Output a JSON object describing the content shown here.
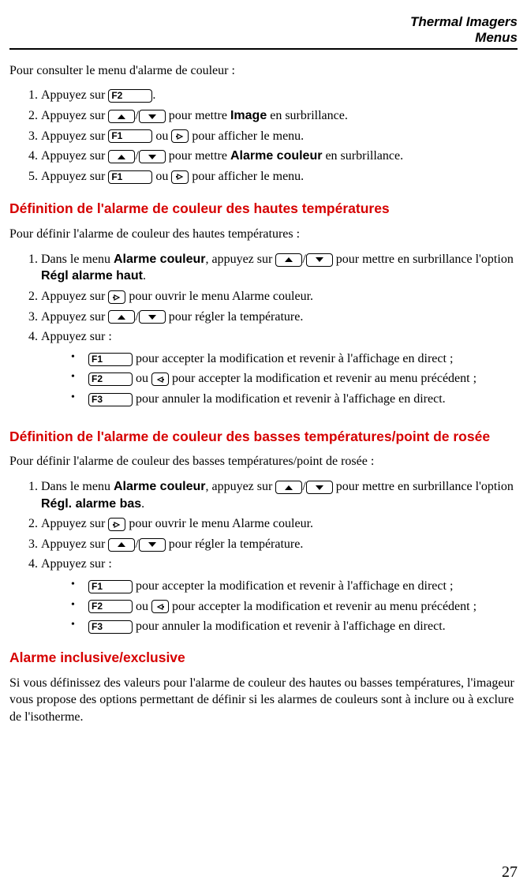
{
  "header": {
    "title1": "Thermal Imagers",
    "title2": "Menus"
  },
  "keys": {
    "F1": "F1",
    "F2": "F2",
    "F3": "F3"
  },
  "para1": "Pour consulter le menu d'alarme de couleur :",
  "list1": [
    {
      "pre": "Appuyez sur ",
      "key": "F2",
      "post": "."
    },
    {
      "pre": "Appuyez sur ",
      "mid": " pour mettre ",
      "bold": "Image",
      "post": " en surbrillance."
    },
    {
      "pre": "Appuyez sur ",
      "key": "F1",
      "mid": " ou ",
      "post": " pour afficher le menu."
    },
    {
      "pre": "Appuyez sur ",
      "mid": " pour mettre ",
      "bold": "Alarme couleur",
      "post": " en surbrillance."
    },
    {
      "pre": "Appuyez sur ",
      "key": "F1",
      "mid": " ou ",
      "post": " pour afficher le menu."
    }
  ],
  "section2": {
    "heading": "Définition de l'alarme de couleur des hautes températures",
    "intro": "Pour définir l'alarme de couleur des hautes températures :",
    "item1": {
      "pre": "Dans le menu ",
      "bold1": "Alarme couleur",
      "mid1": ", appuyez sur ",
      "mid2": " pour mettre en surbrillance l'option ",
      "bold2": "Régl alarme haut",
      "post": "."
    },
    "item2": {
      "pre": "Appuyez sur ",
      "post": " pour ouvrir le menu Alarme couleur."
    },
    "item3": {
      "pre": "Appuyez sur ",
      "post": " pour régler la température."
    },
    "item4": {
      "text": "Appuyez sur :",
      "b1": " pour accepter la modification et revenir à l'affichage en direct ;",
      "b2a": " ou ",
      "b2b": " pour accepter la modification et revenir au menu précédent ;",
      "b3": " pour annuler la modification et revenir à l'affichage en direct."
    }
  },
  "section3": {
    "heading": "Définition de l'alarme de couleur des basses températures/point de rosée",
    "intro": "Pour définir l'alarme de couleur des basses températures/point de rosée :",
    "item1": {
      "pre": "Dans le menu ",
      "bold1": "Alarme couleur",
      "mid1": ", appuyez sur ",
      "mid2": " pour mettre en surbrillance l'option ",
      "bold2": "Régl. alarme bas",
      "post": "."
    },
    "item2": {
      "pre": "Appuyez sur ",
      "post": " pour ouvrir le menu Alarme couleur."
    },
    "item3": {
      "pre": "Appuyez sur ",
      "post": " pour régler la température."
    },
    "item4": {
      "text": "Appuyez sur :",
      "b1": " pour accepter la modification et revenir à l'affichage en direct ;",
      "b2a": " ou ",
      "b2b": " pour accepter la modification et revenir au menu précédent ;",
      "b3": " pour annuler la modification et revenir à l'affichage en direct."
    }
  },
  "section4": {
    "heading": "Alarme inclusive/exclusive",
    "body": "Si vous définissez des valeurs pour l'alarme de couleur des hautes ou basses températures, l'imageur vous propose des options permettant de définir si les alarmes de couleurs sont à inclure ou à exclure de l'isotherme."
  },
  "page_number": "27"
}
